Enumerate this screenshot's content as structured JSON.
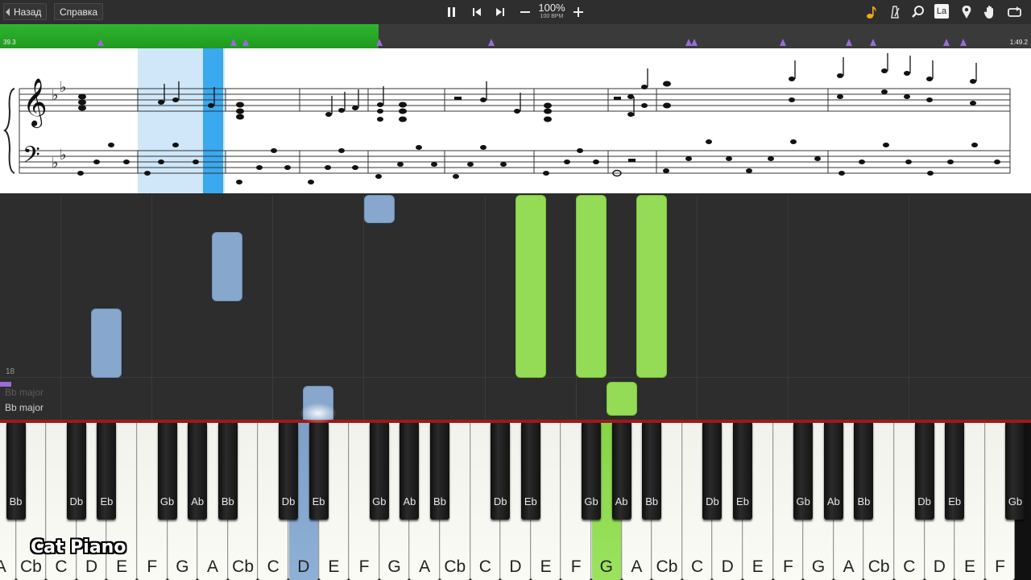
{
  "toolbar": {
    "back_label": "Назад",
    "help_label": "Справка",
    "speed_percent": "100%",
    "speed_bpm": "100 BPM",
    "right_icons": [
      "note-icon",
      "metronome-icon",
      "zoom-icon",
      "label-icon",
      "location-icon",
      "hand-icon",
      "loop-icon"
    ],
    "label_icon_text": "La"
  },
  "progress": {
    "current_time": "39.3",
    "total_time": "1:49.2",
    "fraction": 0.367,
    "color": "#2fb52f"
  },
  "fall_area": {
    "measure_number": "18",
    "key_signature": "Bb major",
    "key_signature_ghost": "Bb major"
  },
  "keyboard": {
    "white_keys": [
      "A",
      "Cb",
      "C",
      "D",
      "E",
      "F",
      "G",
      "A",
      "Cb",
      "C",
      "D",
      "E",
      "F",
      "G",
      "A",
      "Cb",
      "C",
      "D",
      "E",
      "F",
      "G",
      "A",
      "Cb",
      "C",
      "D",
      "E",
      "F",
      "G",
      "A",
      "Cb",
      "C",
      "D",
      "E",
      "F"
    ],
    "black_keys": [
      "Bb",
      "Db",
      "Eb",
      "Gb",
      "Ab",
      "Bb",
      "Db",
      "Eb",
      "Gb",
      "Ab",
      "Bb",
      "Db",
      "Eb",
      "Gb",
      "Ab",
      "Bb",
      "Db",
      "Eb",
      "Gb",
      "Ab",
      "Bb",
      "Db",
      "Eb",
      "Gb"
    ],
    "pressed_blue": "D",
    "pressed_green": "G",
    "blue_color": "#87a7cc",
    "green_color": "#94dc55"
  },
  "watermark": "Cat Piano"
}
